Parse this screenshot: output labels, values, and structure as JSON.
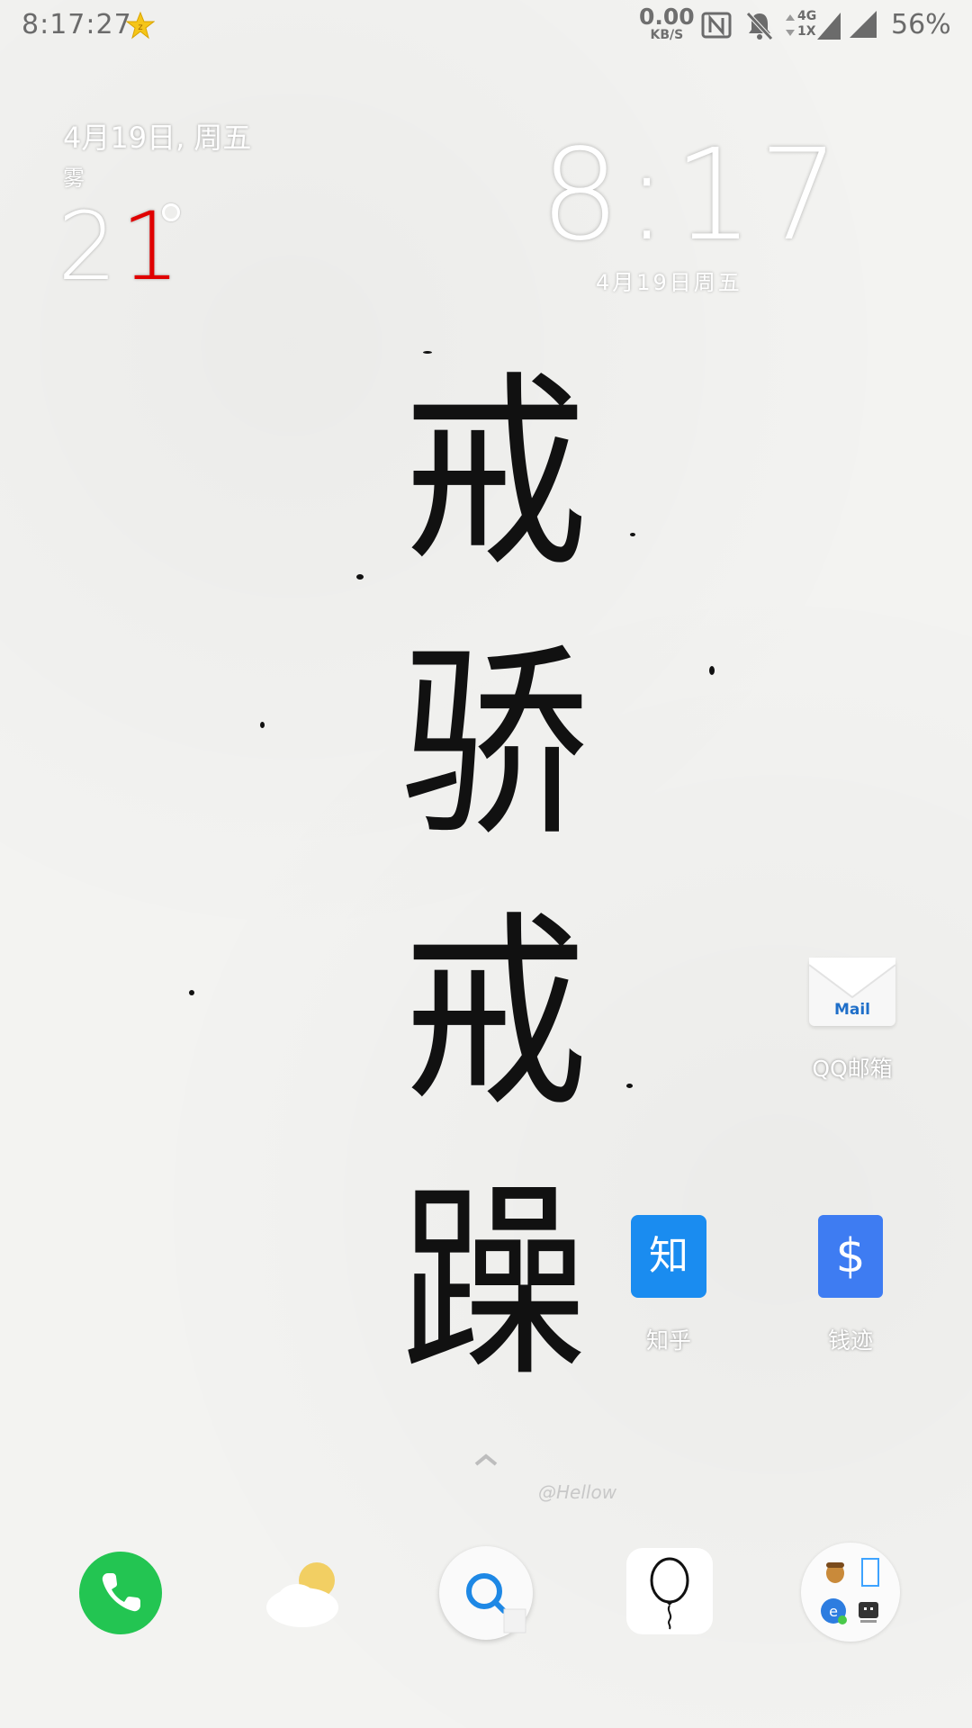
{
  "status_bar": {
    "time": "8:17:27",
    "net_speed_value": "0.00",
    "net_speed_unit": "KB/S",
    "data_top": "4G",
    "data_bottom": "1X",
    "battery": "56%"
  },
  "weather_widget": {
    "date": "4月19日, 周五",
    "condition": "雾",
    "temp_first_digit": "2",
    "temp_second_digit": "1"
  },
  "clock_widget": {
    "time": "8:17",
    "date": "4月19日周五"
  },
  "wallpaper": {
    "calligraphy": [
      "戒",
      "骄",
      "戒",
      "躁"
    ],
    "credit": "@Hellow"
  },
  "apps": {
    "qqmail": {
      "label": "QQ邮箱",
      "icon_text": "Mail"
    },
    "zhihu": {
      "label": "知乎",
      "icon_text": "知"
    },
    "qianji": {
      "label": "钱迹",
      "icon_text": "$"
    }
  },
  "dock": {
    "items": [
      "phone-icon",
      "weather-icon",
      "search-icon",
      "balloon-icon",
      "folder-icon"
    ]
  },
  "colors": {
    "phone_green": "#23c552",
    "zhihu_blue": "#1a8cf0",
    "qianji_blue": "#3e7cf2",
    "temp_red": "#e00000"
  }
}
